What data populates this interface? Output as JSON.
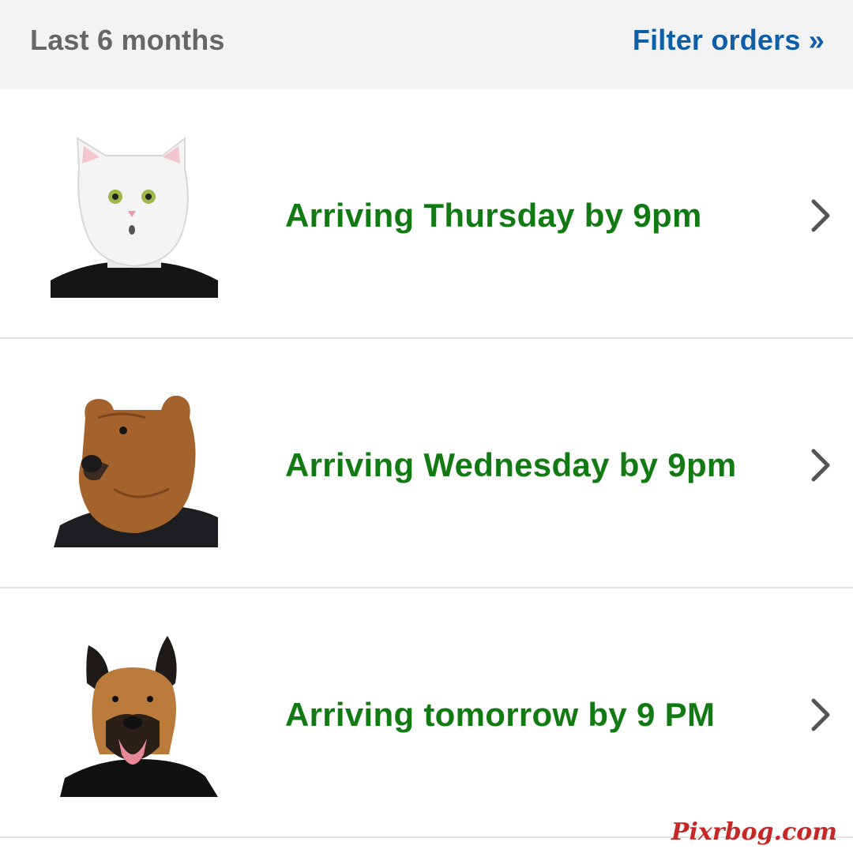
{
  "header": {
    "range_label": "Last 6 months",
    "filter_label": "Filter orders »",
    "filter_color": "#0f5fa6"
  },
  "orders": [
    {
      "status": "Arriving Thursday by 9pm",
      "item_image": "cat-mask-image",
      "chevron_icon": "chevron-right-icon"
    },
    {
      "status": "Arriving Wednesday by 9pm",
      "item_image": "bear-mask-image",
      "chevron_icon": "chevron-right-icon"
    },
    {
      "status": "Arriving tomorrow by 9 PM",
      "item_image": "dog-mask-image",
      "chevron_icon": "chevron-right-icon"
    }
  ],
  "status_color": "#117a13",
  "watermark": "Pixrbog.com"
}
